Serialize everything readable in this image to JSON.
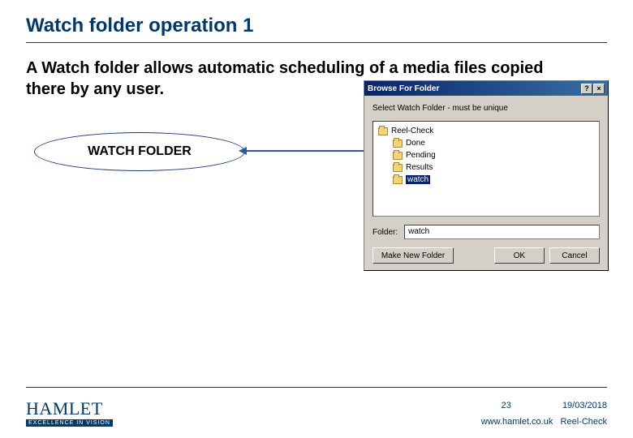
{
  "title": "Watch folder operation 1",
  "body_text": "A Watch folder allows automatic scheduling of a media files copied there by any user.",
  "callout_label": "WATCH FOLDER",
  "dialog": {
    "title": "Browse For Folder",
    "help_btn": "?",
    "close_btn": "×",
    "instruction": "Select Watch Folder - must be unique",
    "tree": {
      "root": "Reel-Check",
      "items": [
        "Done",
        "Pending",
        "Results",
        "watch"
      ],
      "selected": "watch"
    },
    "folder_label": "Folder:",
    "folder_value": "watch",
    "make_new": "Make New Folder",
    "ok": "OK",
    "cancel": "Cancel"
  },
  "footer": {
    "logo": "HAMLET",
    "tagline": "EXCELLENCE IN VISION",
    "page": "23",
    "date": "19/03/2018",
    "url": "www.hamlet.co.uk",
    "product": "Reel-Check"
  }
}
